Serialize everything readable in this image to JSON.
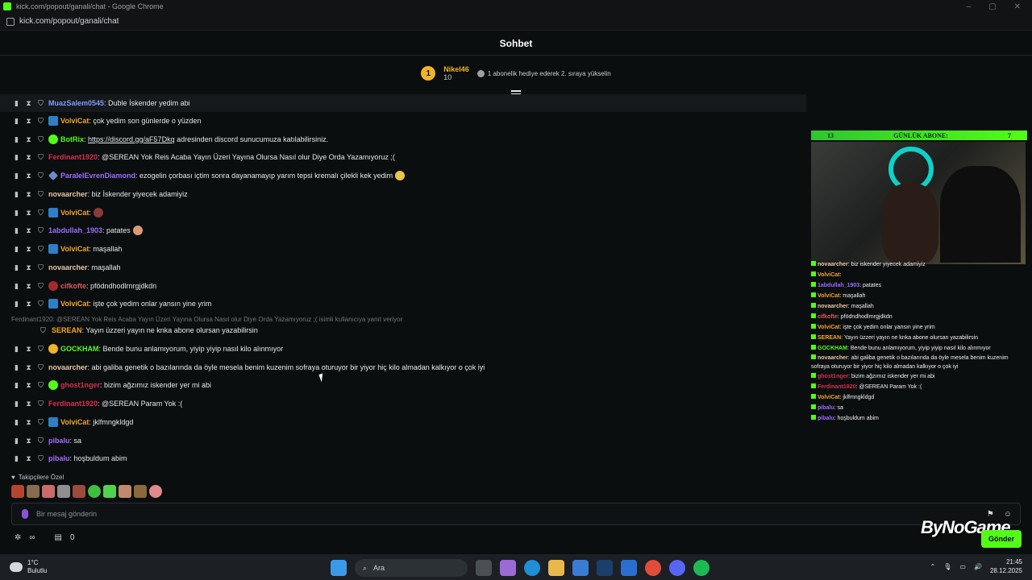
{
  "window": {
    "title": "kick.com/popout/ganali/chat - Google Chrome",
    "url": "kick.com/popout/ganali/chat"
  },
  "header": {
    "title": "Sohbet"
  },
  "pinned": {
    "rank": "1",
    "user": "Nikel46",
    "count": "10",
    "hint": "1 abonelik hediye ederek 2. sıraya yükselin"
  },
  "messages": [
    {
      "user": "MuazSalem0545",
      "color": "#7b9cff",
      "text": ": Duble İskender yedim abi",
      "badge": ""
    },
    {
      "user": "VolviCat",
      "color": "#f5a623",
      "text": ": çok yedim son günlerde o yüzden",
      "badge": "blue"
    },
    {
      "user": "BotRix",
      "color": "#53fc18",
      "text": ": ",
      "link": "https://discord.gg/aF57Dkq",
      "text2": " adresinden discord sunucumuza katılabilirsiniz.",
      "badge": "green"
    },
    {
      "user": "Ferdinant1920",
      "color": "#d9304f",
      "text": ": @SEREAN Yok Reis Acaba Yayın Üzeri Yayına Olursa Nasıl olur Diye Orda Yazamıyoruz ;(",
      "badge": ""
    },
    {
      "user": "ParalelEvrenDiamond",
      "color": "#a16bff",
      "text": ": ezogelin çorbası içtim sonra dayanamayıp yarım tepsi kremalı çilekli kek yedim",
      "badge": "diamond"
    },
    {
      "user": "novaarcher",
      "color": "#e8c7a8",
      "text": ": biz İskender yiyecek adamiyiz",
      "badge": ""
    },
    {
      "user": "VolviCat",
      "color": "#f5a623",
      "text": ":",
      "badge": "blue"
    },
    {
      "user": "1abdullah_1903",
      "color": "#9b6cff",
      "text": ": patates",
      "badge": ""
    },
    {
      "user": "VolviCat",
      "color": "#f5a623",
      "text": ": maşallah",
      "badge": "blue"
    },
    {
      "user": "novaarcher",
      "color": "#e8c7a8",
      "text": ": maşallah",
      "badge": ""
    },
    {
      "user": "cifkofte",
      "color": "#e05a5a",
      "text": ": pfödndhodlrnrgjdkdn",
      "badge": "red"
    },
    {
      "user": "VolviCat",
      "color": "#f5a623",
      "text": ": işte çok yedim onlar yansın yine yrim",
      "badge": "blue"
    },
    {
      "user": "SEREAN",
      "color": "#f5a623",
      "text": ": Yayın üzzeri yayın ne knka abone olursan yazabilirsin",
      "badge": ""
    },
    {
      "user": "GOCKHAM",
      "color": "#53fc18",
      "text": ": Bende bunu anlamıyorum, yiyip yiyip nasıl kilo alınmıyor",
      "badge": "gold"
    },
    {
      "user": "novaarcher",
      "color": "#e8c7a8",
      "text": ": abi galiba genetik o bazılarında da öyle mesela benim kuzenim sofraya oturuyor bir yiyor hiç kilo almadan kalkıyor o çok iyi",
      "badge": ""
    },
    {
      "user": "ghost1nger",
      "color": "#d9304f",
      "text": ": bizim ağzımız iskender yer mi abi",
      "badge": "green"
    },
    {
      "user": "Ferdinant1920",
      "color": "#d9304f",
      "text": ": @SEREAN Param Yok :(",
      "badge": ""
    },
    {
      "user": "VolviCat",
      "color": "#f5a623",
      "text": ": jklfmngkldgd",
      "badge": "blue"
    },
    {
      "user": "pibalu",
      "color": "#a16bff",
      "text": ": sa",
      "badge": ""
    },
    {
      "user": "pibalu",
      "color": "#a16bff",
      "text": ": hoşbuldum abim",
      "badge": ""
    }
  ],
  "reply_line": "Ferdinant1920: @SEREAN Yok Reis Acaba Yayın Üzeri Yayına Olursa Nasıl olur Diye Orda Yazamıyoruz ;( isimli kullanıcıya yanıt veriyor",
  "composer": {
    "follower_label": "Takipçilere Özel",
    "placeholder": "Bir mesaj gönderin",
    "send_label": "Gönder",
    "points": "0"
  },
  "watermark": "ByNoGame",
  "overlay": {
    "sub_left": "13",
    "sub_title": "GÜNLÜK ABONE:",
    "sub_right": "7",
    "mini_chat": [
      {
        "user": "novaarcher",
        "text": ": biz iskender yiyecek adamiyiz"
      },
      {
        "user": "VolviCat",
        "text": ":"
      },
      {
        "user": "1abdullah_1903",
        "text": ": patates"
      },
      {
        "user": "VolviCat",
        "text": ": maşallah"
      },
      {
        "user": "novaarcher",
        "text": ": maşallah"
      },
      {
        "user": "cifkofte",
        "text": ": pfödndhodlrnrgjdkdn"
      },
      {
        "user": "VolviCat",
        "text": ": işte çok yedim onlar yansın yine yrim"
      },
      {
        "user": "SEREAN",
        "text": ": Yayın üzzeri yayın ne knka abone olursan yazabilirsin"
      },
      {
        "user": "GOCKHAM",
        "text": ": Bende bunu anlamıyorum, yiyip yiyip nasıl kilo alınmıyor"
      },
      {
        "user": "novaarcher",
        "text": ": abi galiba genetik o bazılarında da öyle mesela benim kuzenim sofraya oturuyor bir yiyor hiç kilo almadan kalkıyor o çok iyi"
      },
      {
        "user": "ghost1nger",
        "text": ": bizim ağzımız iskender yer mi abi"
      },
      {
        "user": "Ferdinant1920",
        "text": ": @SEREAN Param Yok :("
      },
      {
        "user": "VolviCat",
        "text": ": jklfmngkldgd"
      },
      {
        "user": "pibalu",
        "text": ": sa"
      },
      {
        "user": "pibalu",
        "text": ": hoşbuldum abim"
      }
    ]
  },
  "taskbar": {
    "temp": "1°C",
    "weather": "Bulutlu",
    "search": "Ara",
    "time": "21:45",
    "date": "28.12.2025"
  }
}
